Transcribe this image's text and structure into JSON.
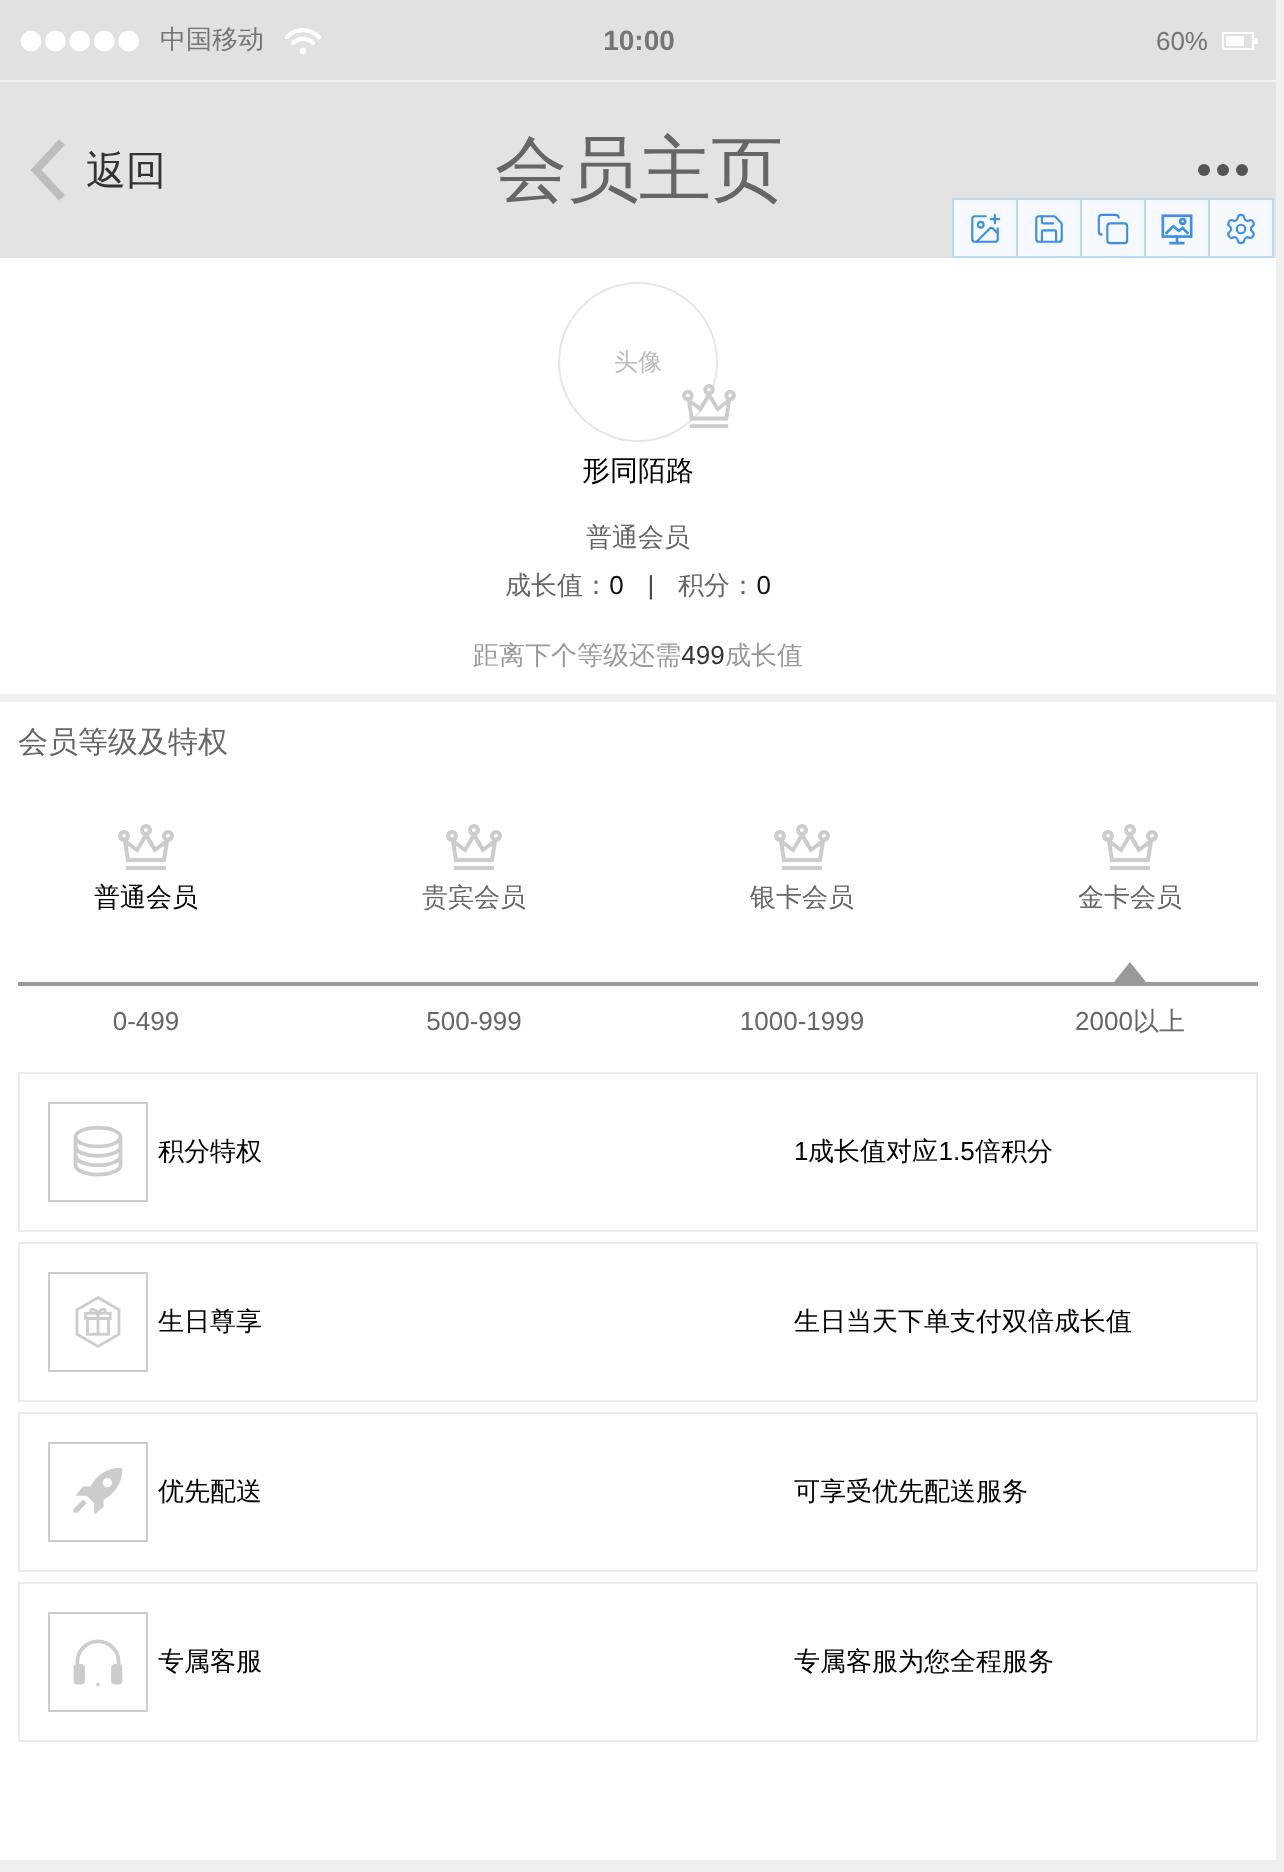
{
  "status_bar": {
    "carrier": "中国移动",
    "time": "10:00",
    "battery": "60%"
  },
  "nav_bar": {
    "back": "返回",
    "title": "会员主页"
  },
  "profile": {
    "avatar": "头像",
    "name": "形同陌路",
    "level": "普通会员",
    "growth_label": "成长值：",
    "growth_value": "0",
    "separator": "|",
    "points_label": "积分：",
    "points_value": "0",
    "hint_before": "距离下个等级还需",
    "hint_value": "499",
    "hint_after": "成长值"
  },
  "levels": {
    "title": "会员等级及特权",
    "items": [
      {
        "name": "普通会员",
        "range": "0-499",
        "selected": true,
        "pointer": false
      },
      {
        "name": "贵宾会员",
        "range": "500-999",
        "selected": false,
        "pointer": false
      },
      {
        "name": "银卡会员",
        "range": "1000-1999",
        "selected": false,
        "pointer": false
      },
      {
        "name": "金卡会员",
        "range": "2000以上",
        "selected": false,
        "pointer": true
      }
    ]
  },
  "privileges": [
    {
      "kind": "coins",
      "name": "积分特权",
      "description": "1成长值对应1.5倍积分"
    },
    {
      "kind": "gift",
      "name": "生日尊享",
      "description": "生日当天下单支付双倍成长值"
    },
    {
      "kind": "rocket",
      "name": "优先配送",
      "description": "可享受优先配送服务"
    },
    {
      "kind": "headset",
      "name": "专属客服",
      "description": "专属客服为您全程服务"
    }
  ]
}
